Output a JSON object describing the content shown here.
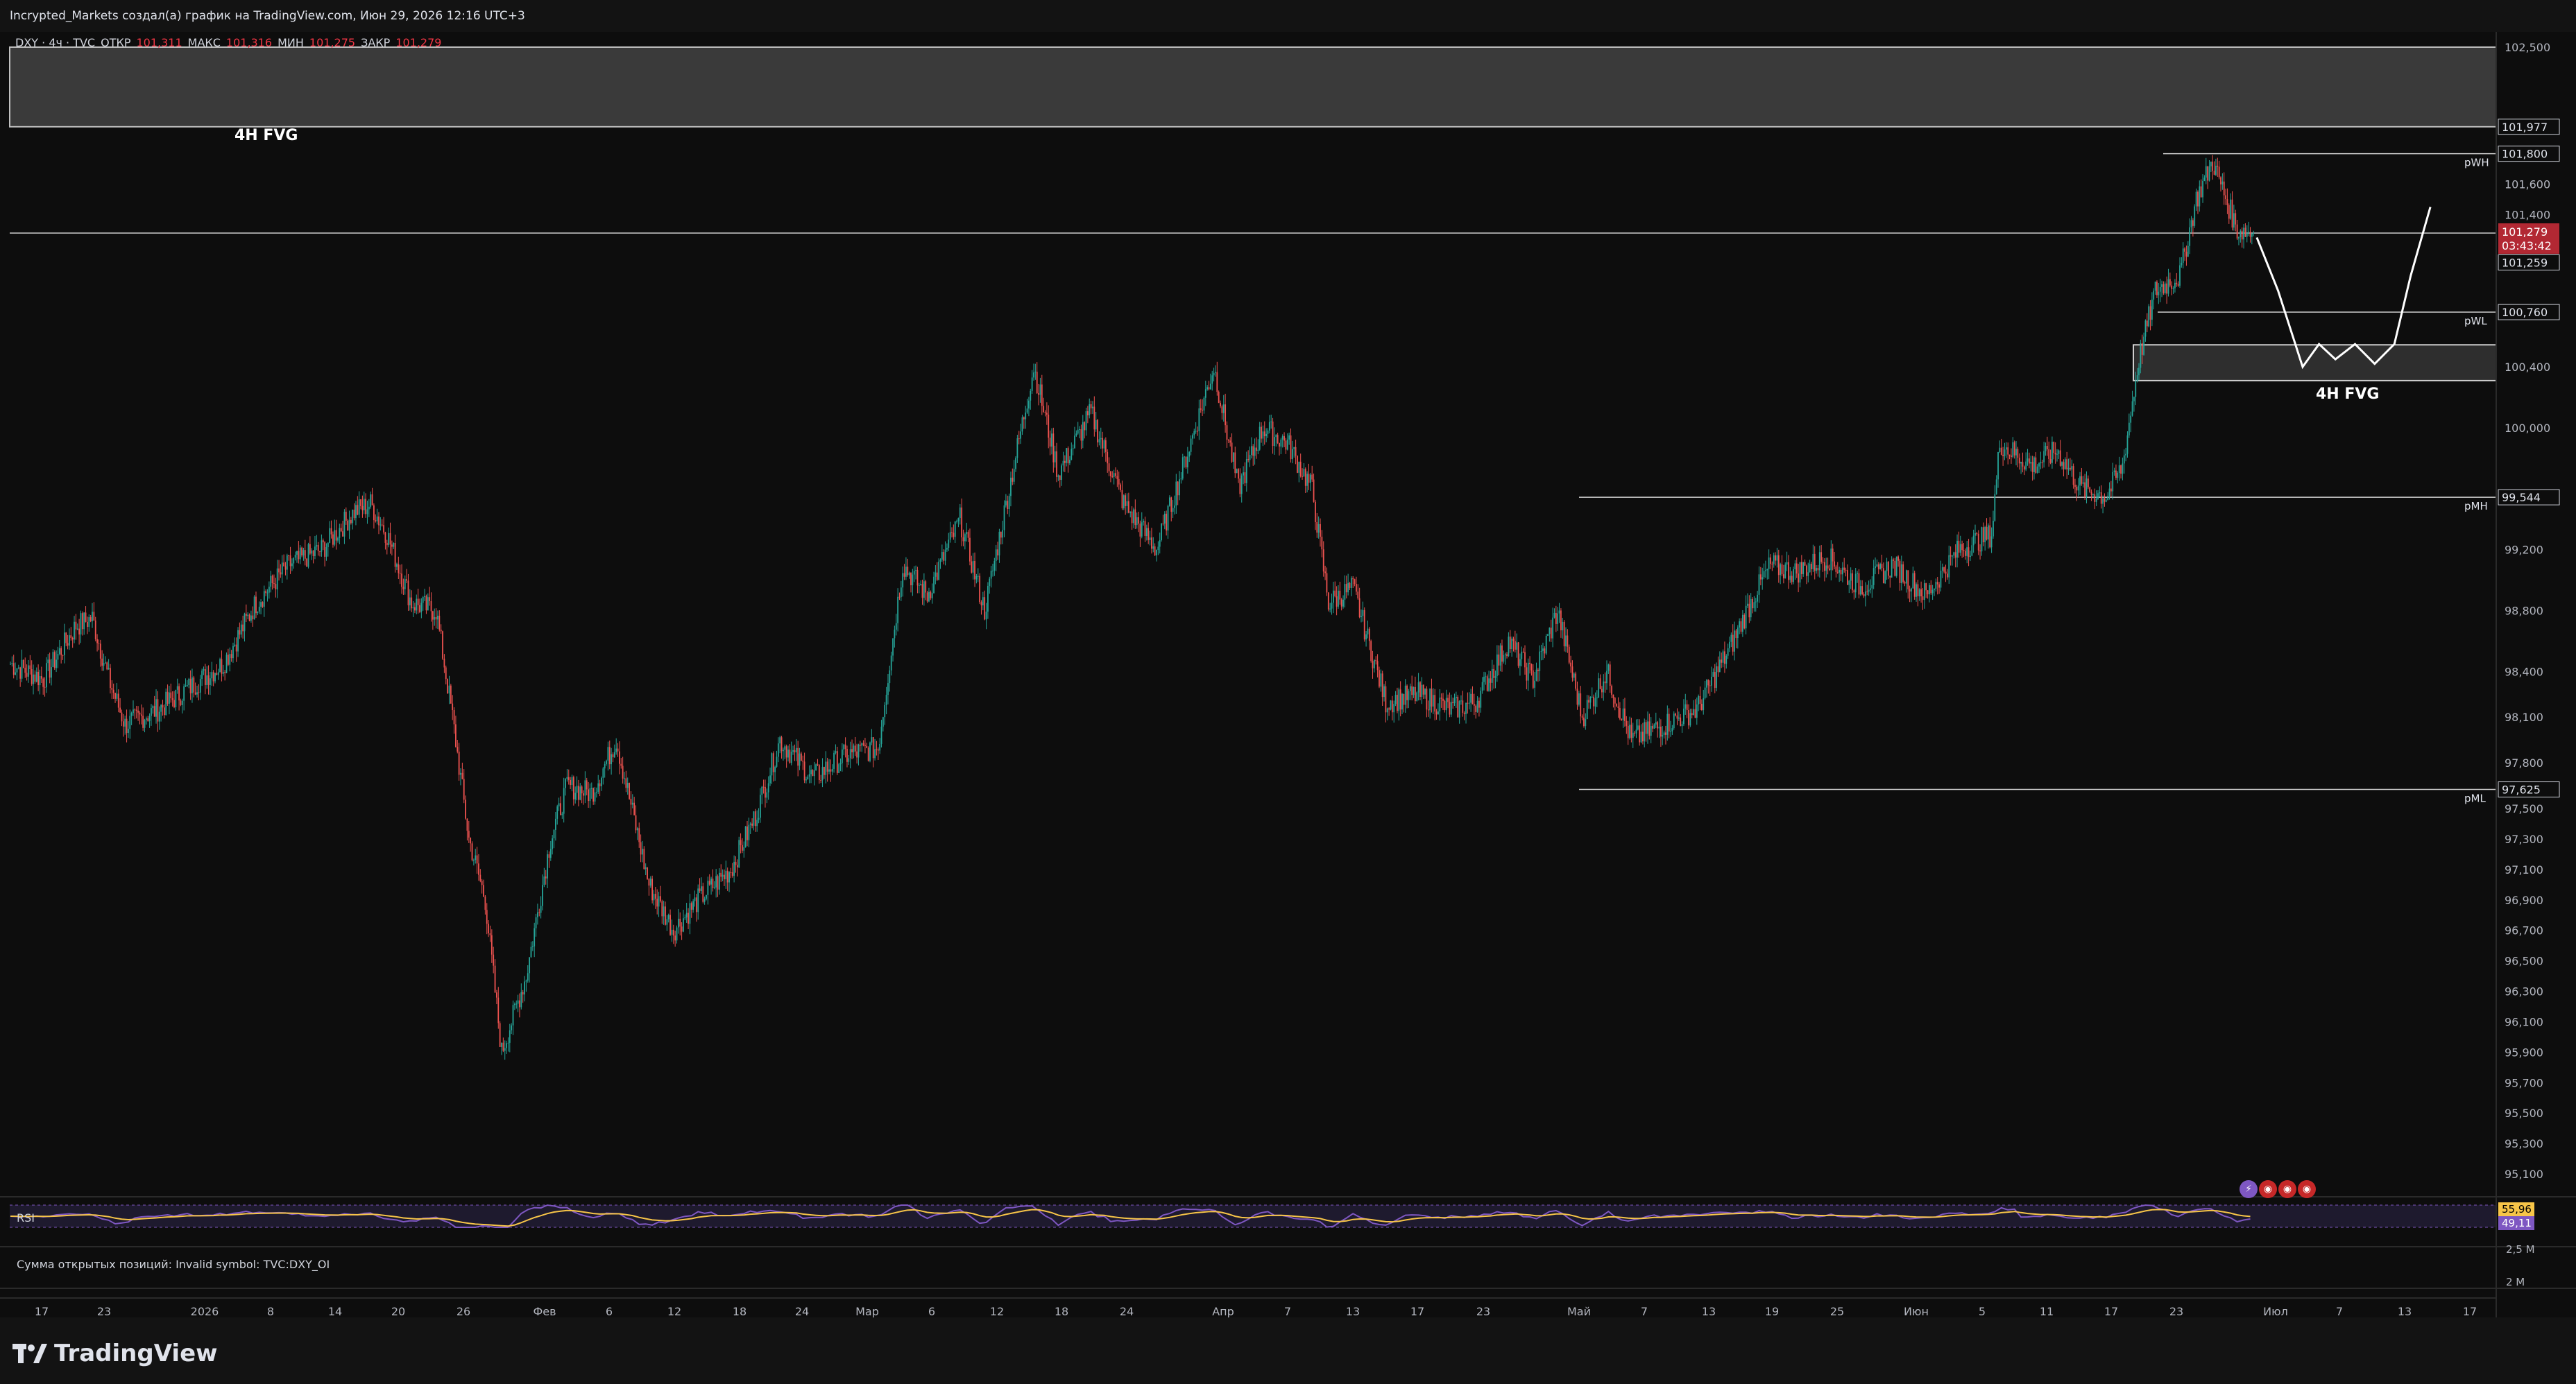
{
  "header": {
    "credit": "Incrypted_Markets создал(а) график на TradingView.com, Июн 29, 2026 12:16 UTC+3"
  },
  "legend": {
    "symbol": "DXY · 4ч · TVC",
    "open_label": "ОТКР",
    "open": "101,311",
    "high_label": "МАКС",
    "high": "101,316",
    "low_label": "МИН",
    "low": "101,275",
    "close_label": "ЗАКР",
    "close": "101,279"
  },
  "colors": {
    "background": "#0d0d0d",
    "up_candle": "#26a69a",
    "down_candle": "#ef5350",
    "current_price_badge": "#b22833",
    "rsi_line": "#7e57c2",
    "rsi_ma": "#f7c548"
  },
  "annotations": {
    "fvg_left": "4H FVG",
    "fvg_right": "4H FVG",
    "pwh": "pWH",
    "pwl": "pWL",
    "pmh": "pMH",
    "pml": "pML"
  },
  "price_axis": {
    "ticks": [
      "102,500",
      "101,600",
      "101,400",
      "100,400",
      "100,000",
      "99,200",
      "98,800",
      "98,400",
      "98,100",
      "97,800",
      "97,500",
      "97,300",
      "97,100",
      "96,900",
      "96,700",
      "96,500",
      "96,300",
      "96,100",
      "95,900",
      "95,700",
      "95,500",
      "95,300",
      "95,100"
    ],
    "badges": {
      "upper_level": "101,977",
      "pwh_level": "101,800",
      "current_price": "101,279",
      "countdown": "03:43:42",
      "current_line": "101,259",
      "pwl_level": "100,760",
      "pmh_level": "99,544",
      "pml_level": "97,625"
    },
    "rsi_values": [
      "55,96",
      "49,11"
    ],
    "oi_ticks": [
      "2,5 М",
      "2 М"
    ]
  },
  "time_axis": {
    "labels": [
      "17",
      "23",
      "2026",
      "8",
      "14",
      "20",
      "26",
      "Фев",
      "6",
      "12",
      "18",
      "24",
      "Мар",
      "6",
      "12",
      "18",
      "24",
      "Апр",
      "7",
      "13",
      "17",
      "23",
      "Май",
      "7",
      "13",
      "19",
      "25",
      "Июн",
      "5",
      "11",
      "17",
      "23",
      "Июл",
      "7",
      "13",
      "17"
    ]
  },
  "indicators": {
    "rsi_label": "RSI",
    "oi_label": "Сумма открытых позиций: Invalid symbol: TVC:DXY_OI"
  },
  "chart_data": {
    "type": "candlestick",
    "symbol": "DXY",
    "timeframe": "4ч",
    "ylim": [
      94.95,
      102.6
    ],
    "anchors": [
      [
        0,
        98.45
      ],
      [
        20,
        98.35
      ],
      [
        40,
        98.7
      ],
      [
        50,
        98.75
      ],
      [
        60,
        98.35
      ],
      [
        70,
        98.05
      ],
      [
        90,
        98.15
      ],
      [
        110,
        98.3
      ],
      [
        130,
        98.45
      ],
      [
        150,
        98.85
      ],
      [
        170,
        99.1
      ],
      [
        190,
        99.2
      ],
      [
        210,
        99.45
      ],
      [
        220,
        99.5
      ],
      [
        230,
        99.3
      ],
      [
        245,
        98.85
      ],
      [
        260,
        98.8
      ],
      [
        270,
        98.1
      ],
      [
        280,
        97.3
      ],
      [
        290,
        96.9
      ],
      [
        300,
        95.9
      ],
      [
        315,
        96.4
      ],
      [
        330,
        97.3
      ],
      [
        340,
        97.65
      ],
      [
        355,
        97.6
      ],
      [
        370,
        97.95
      ],
      [
        390,
        97.0
      ],
      [
        405,
        96.7
      ],
      [
        420,
        96.9
      ],
      [
        440,
        97.1
      ],
      [
        455,
        97.45
      ],
      [
        470,
        97.95
      ],
      [
        490,
        97.7
      ],
      [
        510,
        97.85
      ],
      [
        530,
        97.9
      ],
      [
        545,
        99.1
      ],
      [
        560,
        98.9
      ],
      [
        580,
        99.4
      ],
      [
        595,
        98.8
      ],
      [
        610,
        99.6
      ],
      [
        625,
        100.4
      ],
      [
        640,
        99.7
      ],
      [
        660,
        100.1
      ],
      [
        680,
        99.5
      ],
      [
        700,
        99.2
      ],
      [
        715,
        99.7
      ],
      [
        735,
        100.4
      ],
      [
        750,
        99.6
      ],
      [
        765,
        100.0
      ],
      [
        780,
        99.9
      ],
      [
        795,
        99.6
      ],
      [
        805,
        98.85
      ],
      [
        820,
        98.95
      ],
      [
        840,
        98.2
      ],
      [
        860,
        98.25
      ],
      [
        880,
        98.15
      ],
      [
        895,
        98.2
      ],
      [
        915,
        98.6
      ],
      [
        930,
        98.35
      ],
      [
        945,
        98.8
      ],
      [
        960,
        98.1
      ],
      [
        975,
        98.4
      ],
      [
        990,
        97.95
      ],
      [
        1010,
        98.05
      ],
      [
        1030,
        98.15
      ],
      [
        1050,
        98.55
      ],
      [
        1065,
        98.9
      ],
      [
        1075,
        99.1
      ],
      [
        1090,
        99.05
      ],
      [
        1110,
        99.15
      ],
      [
        1130,
        98.95
      ],
      [
        1150,
        99.1
      ],
      [
        1170,
        98.9
      ],
      [
        1190,
        99.2
      ],
      [
        1210,
        99.3
      ],
      [
        1215,
        99.9
      ],
      [
        1235,
        99.75
      ],
      [
        1250,
        99.85
      ],
      [
        1265,
        99.6
      ],
      [
        1280,
        99.55
      ],
      [
        1290,
        99.75
      ],
      [
        1300,
        100.45
      ],
      [
        1310,
        100.9
      ],
      [
        1325,
        101.0
      ],
      [
        1335,
        101.5
      ],
      [
        1345,
        101.75
      ],
      [
        1360,
        101.3
      ],
      [
        1370,
        101.28
      ]
    ],
    "levels": [
      {
        "name": "pWH",
        "value": 101.8
      },
      {
        "name": "current",
        "value": 101.279
      },
      {
        "name": "pWL",
        "value": 100.76
      },
      {
        "name": "pMH",
        "value": 99.544
      },
      {
        "name": "pML",
        "value": 97.625
      }
    ],
    "zones": [
      {
        "name": "4H FVG",
        "from": 101.977,
        "to": 102.5
      },
      {
        "name": "4H FVG",
        "from": 100.31,
        "to": 100.545
      }
    ],
    "projection": [
      [
        1372,
        101.25
      ],
      [
        1385,
        100.9
      ],
      [
        1400,
        100.4
      ],
      [
        1410,
        100.55
      ],
      [
        1420,
        100.45
      ],
      [
        1432,
        100.55
      ],
      [
        1444,
        100.42
      ],
      [
        1456,
        100.55
      ],
      [
        1466,
        101.0
      ],
      [
        1478,
        101.45
      ]
    ]
  }
}
